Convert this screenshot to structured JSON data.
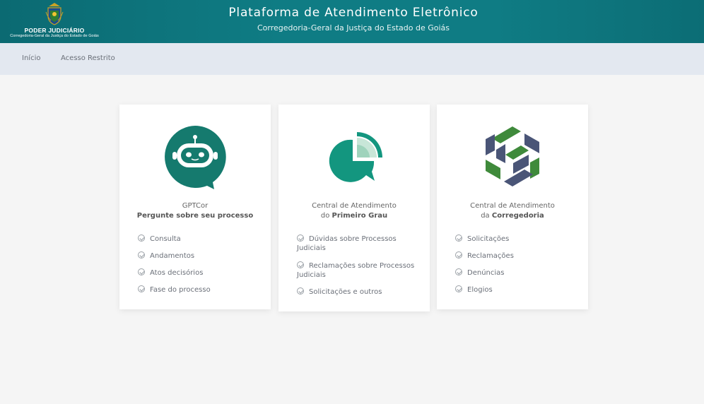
{
  "header": {
    "brand_name": "PODER JUDICIÁRIO",
    "brand_sub": "Corregedoria-Geral da Justiça do Estado de Goiás",
    "title": "Plataforma de Atendimento Eletrônico",
    "subtitle": "Corregedoria-Geral da Justiça do Estado de Goiás",
    "bar_color": "#0f7c84"
  },
  "nav": {
    "items": [
      {
        "label": "Início"
      },
      {
        "label": "Acesso Restrito"
      }
    ]
  },
  "cards": [
    {
      "icon": "robot-icon",
      "line1": "GPTCor",
      "line2_pre": "",
      "line2_bold": "Pergunte sobre seu processo",
      "features": [
        "Consulta",
        "Andamentos",
        "Atos decisórios",
        "Fase do processo"
      ]
    },
    {
      "icon": "chat-chart-icon",
      "line1": "Central de Atendimento",
      "line2_pre": "do ",
      "line2_bold": "Primeiro Grau",
      "features": [
        "Dúvidas sobre Processos Judiciais",
        "Reclamações sobre Processos Judiciais",
        "Solicitações e outros"
      ]
    },
    {
      "icon": "hexagon-logo-icon",
      "line1": "Central de Atendimento",
      "line2_pre": "da ",
      "line2_bold": "Corregedoria",
      "features": [
        "Solicitações",
        "Reclamações",
        "Denúncias",
        "Elogios"
      ]
    }
  ],
  "colors": {
    "accent": "#13796f",
    "green": "#3f8a3b",
    "slate": "#4a5577",
    "page_bg": "#f5f5f5",
    "nav_bg": "#e3e8f0"
  }
}
